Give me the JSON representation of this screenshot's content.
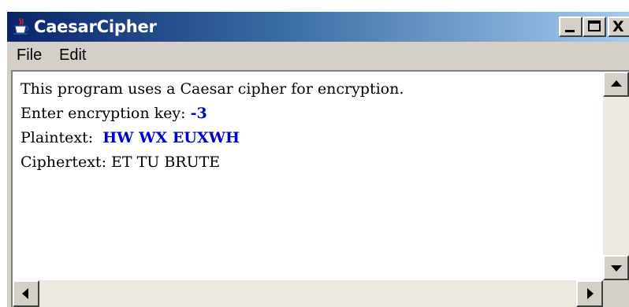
{
  "window": {
    "title": "CaesarCipher",
    "controls": {
      "minimize": "minimize",
      "maximize": "maximize",
      "close": "X"
    }
  },
  "menu": {
    "items": [
      "File",
      "Edit"
    ]
  },
  "console": {
    "line1": "This program uses a Caesar cipher for encryption.",
    "line2_prompt": "Enter encryption key: ",
    "line2_input": "-3",
    "line3_prompt": "Plaintext:  ",
    "line3_input": "HW WX EUXWH",
    "line4": "Ciphertext: ET TU BRUTE"
  },
  "icons": {
    "app": "java-coffee-cup-icon",
    "scroll_up": "arrow-up-icon",
    "scroll_down": "arrow-down-icon",
    "scroll_left": "arrow-left-icon",
    "scroll_right": "arrow-right-icon"
  },
  "colors": {
    "title_bar_start": "#0a246a",
    "title_bar_end": "#a6caf0",
    "window_face": "#d4d0c8",
    "user_input_text": "#0000cc"
  }
}
